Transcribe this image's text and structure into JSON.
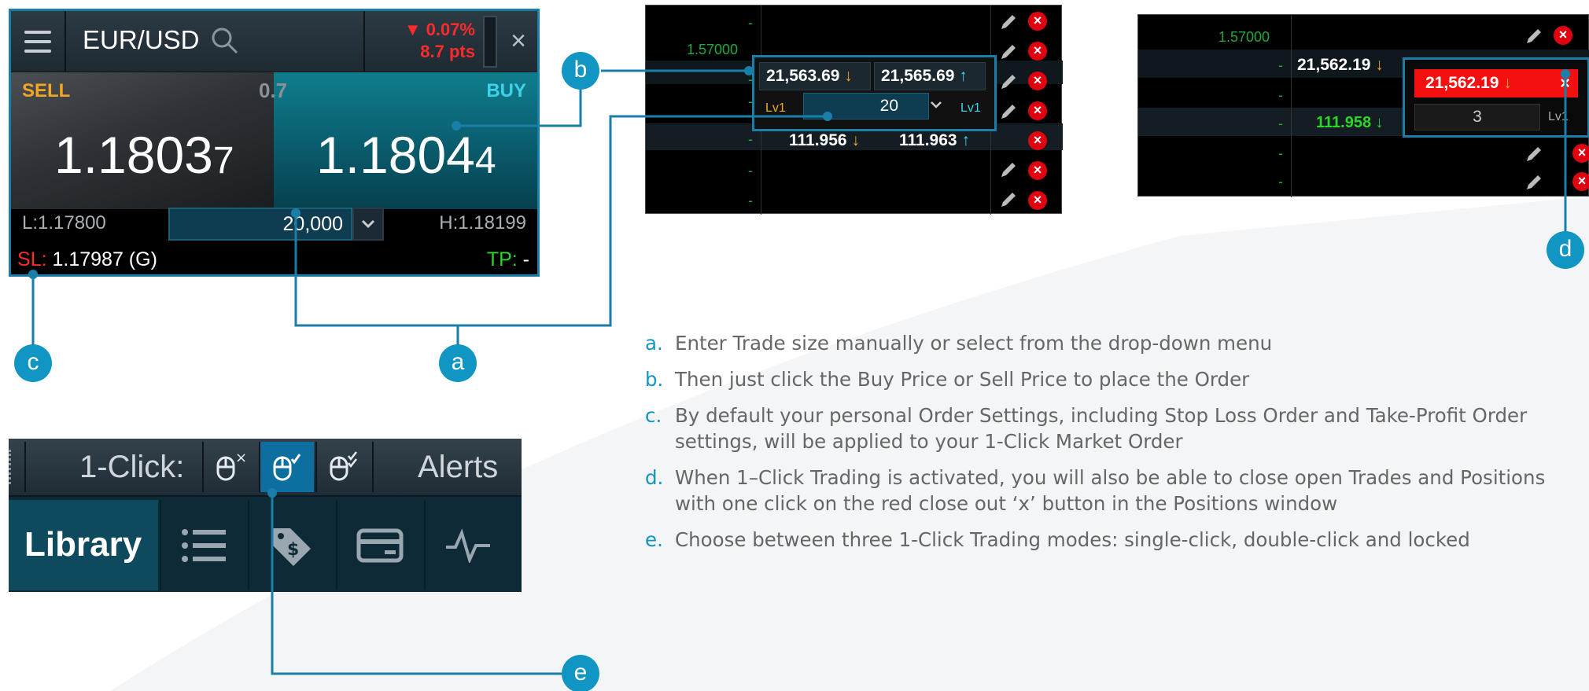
{
  "colors": {
    "accent": "#1196c4",
    "sell": "#f5a623",
    "buy": "#3fd0ea",
    "negative": "#ff2a2a",
    "positive": "#2bd62b"
  },
  "ticket": {
    "symbol": "EUR/USD",
    "change_pct": "▼ 0.07%",
    "change_pts": "8.7 pts",
    "close": "×",
    "sell_label": "SELL",
    "buy_label": "BUY",
    "spread": "0.7",
    "sell_price_main": "1.1803",
    "sell_price_pip": "7",
    "buy_price_main": "1.1804",
    "buy_price_pip": "4",
    "low": "L:1.17800",
    "high": "H:1.18199",
    "quantity": "20,000",
    "sl_label": "SL:",
    "sl_value": "1.17987 (G)",
    "tp_label": "TP:",
    "tp_value": "-"
  },
  "orders_grid": {
    "col_value": "1.57000",
    "dashes": [
      "-",
      "-",
      "-",
      "-",
      "-",
      "-"
    ],
    "sell_price": "21,563.69",
    "buy_price": "21,565.69",
    "level_left": "Lv1",
    "level_right": "Lv1",
    "quantity": "20",
    "row_sell": "111.956",
    "row_buy": "111.963"
  },
  "positions_grid": {
    "col_value": "1.57000",
    "dashes": [
      "-",
      "-",
      "-",
      "-",
      "-"
    ],
    "price": "21,562.19",
    "close_price": "21,562.19",
    "close_x": "×",
    "row_value": "111.958",
    "quantity": "3",
    "level": "Lv1"
  },
  "toolbar": {
    "one_click_label": "1-Click:",
    "alerts_label": "Alerts",
    "library_label": "Library",
    "modes": [
      "single-click",
      "double-click",
      "locked"
    ]
  },
  "callouts": {
    "a": "a",
    "b": "b",
    "c": "c",
    "d": "d",
    "e": "e"
  },
  "notes": [
    {
      "letter": "a.",
      "text": "Enter Trade size manually or select from the drop-down menu"
    },
    {
      "letter": "b.",
      "text": "Then just click the Buy Price or Sell Price to place the Order"
    },
    {
      "letter": "c.",
      "text": "By default your personal Order Settings, including Stop Loss Order and Take-Profit Order settings, will be applied to your 1-Click Market Order"
    },
    {
      "letter": "d.",
      "text": "When 1–Click Trading is activated, you will also be able to close open Trades and Positions with one click on the red close out ‘x’ button in the Positions window"
    },
    {
      "letter": "e.",
      "text": "Choose between three 1-Click Trading modes: single-click, double-click and locked"
    }
  ]
}
